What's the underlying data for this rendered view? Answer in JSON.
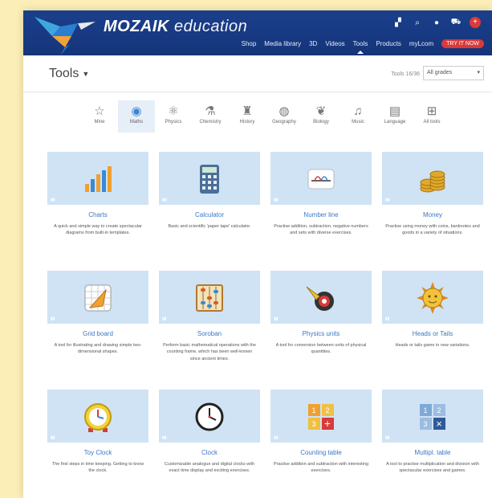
{
  "header": {
    "brand_bold": "MOZAIK",
    "brand_light": "education",
    "top_icons": [
      "grid-icon",
      "search-icon",
      "user-icon",
      "cart-icon",
      "flag-icon"
    ],
    "nav": [
      "Shop",
      "Media library",
      "3D",
      "Videos",
      "Tools",
      "Products",
      "myLcom"
    ],
    "try_label": "TRY IT NOW"
  },
  "toolbar": {
    "title": "Tools",
    "count": "Tools 16/36",
    "grades_value": "All grades"
  },
  "categories": [
    {
      "label": "Mine",
      "icon": "star-icon"
    },
    {
      "label": "Maths",
      "icon": "maths-icon"
    },
    {
      "label": "Physics",
      "icon": "physics-icon"
    },
    {
      "label": "Chemistry",
      "icon": "chemistry-icon"
    },
    {
      "label": "History",
      "icon": "history-icon"
    },
    {
      "label": "Geography",
      "icon": "globe-icon"
    },
    {
      "label": "Biology",
      "icon": "biology-icon"
    },
    {
      "label": "Music",
      "icon": "music-icon"
    },
    {
      "label": "Language",
      "icon": "book-icon"
    },
    {
      "label": "All tools",
      "icon": "grid-icon"
    }
  ],
  "selected_category": "Maths",
  "cards": [
    {
      "title": "Charts",
      "desc": "A quick and simple way to create spectacular diagrams from built-in templates."
    },
    {
      "title": "Calculator",
      "desc": "Basic and scientific 'paper tape' calculator."
    },
    {
      "title": "Number line",
      "desc": "Practise addition, subtraction, negative numbers and sets with diverse exercises."
    },
    {
      "title": "Money",
      "desc": "Practise using money with coins, banknotes and goods in a variety of situations."
    },
    {
      "title": "Grid board",
      "desc": "A tool for illustrating and drawing simple two-dimensional shapes."
    },
    {
      "title": "Soroban",
      "desc": "Perform basic mathematical operations with the counting frame, which has been well-known since ancient times."
    },
    {
      "title": "Physics units",
      "desc": "A tool for conversion between units of physical quantities."
    },
    {
      "title": "Heads or Tails",
      "desc": "Heads or tails game in new variations."
    },
    {
      "title": "Toy Clock",
      "desc": "The first steps in time keeping. Getting to know the clock."
    },
    {
      "title": "Clock",
      "desc": "Customizable analogue and digital clocks with exact time display and exciting exercises."
    },
    {
      "title": "Counting table",
      "desc": "Practise addition and subtraction with interesting exercises."
    },
    {
      "title": "Multipl. table",
      "desc": "A tool to practise multiplication and division with spectacular exercises and games."
    }
  ],
  "colors": {
    "header": "#1b3f8c",
    "accent": "#3b77c4",
    "thumb": "#cfe3f4",
    "try": "#d93a3a",
    "background": "#fbeeb6"
  }
}
